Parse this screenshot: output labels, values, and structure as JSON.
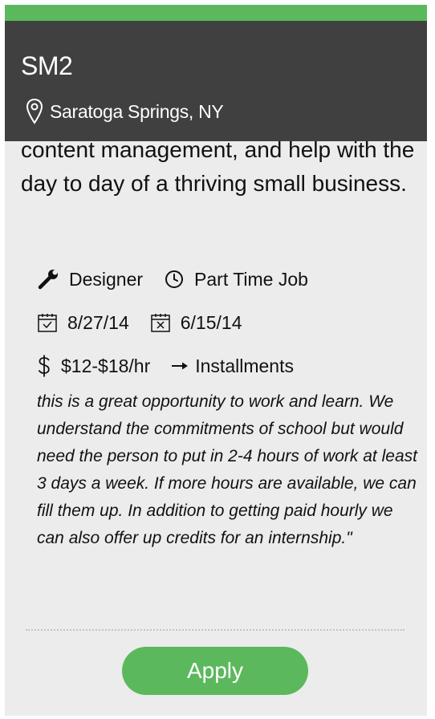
{
  "header": {
    "title": "SM2",
    "location": "Saratoga Springs, NY"
  },
  "description_tail": "content management, and help with the day to day of a thriving small business.",
  "details": {
    "role": "Designer",
    "job_type": "Part Time Job",
    "start_date": "8/27/14",
    "end_date": "6/15/14",
    "pay": "$12-$18/hr",
    "payment_method": "Installments"
  },
  "note": "this is a great opportunity to work and learn. We understand the commitments of school but would need the person to put in 2-4 hours of work at least 3 days a week. If more hours are available, we can fill them up. In addition to getting paid hourly we can also offer up credits for an internship.\"",
  "apply_label": "Apply",
  "icons": {
    "location": "map-pin-icon",
    "role": "wrench-icon",
    "job_type": "clock-icon",
    "start_date": "calendar-check-icon",
    "end_date": "calendar-x-icon",
    "pay": "dollar-icon",
    "payment_method": "arrow-right-icon"
  },
  "colors": {
    "accent": "#5cb85c",
    "header_bg": "#404040",
    "card_bg": "#ececec"
  }
}
